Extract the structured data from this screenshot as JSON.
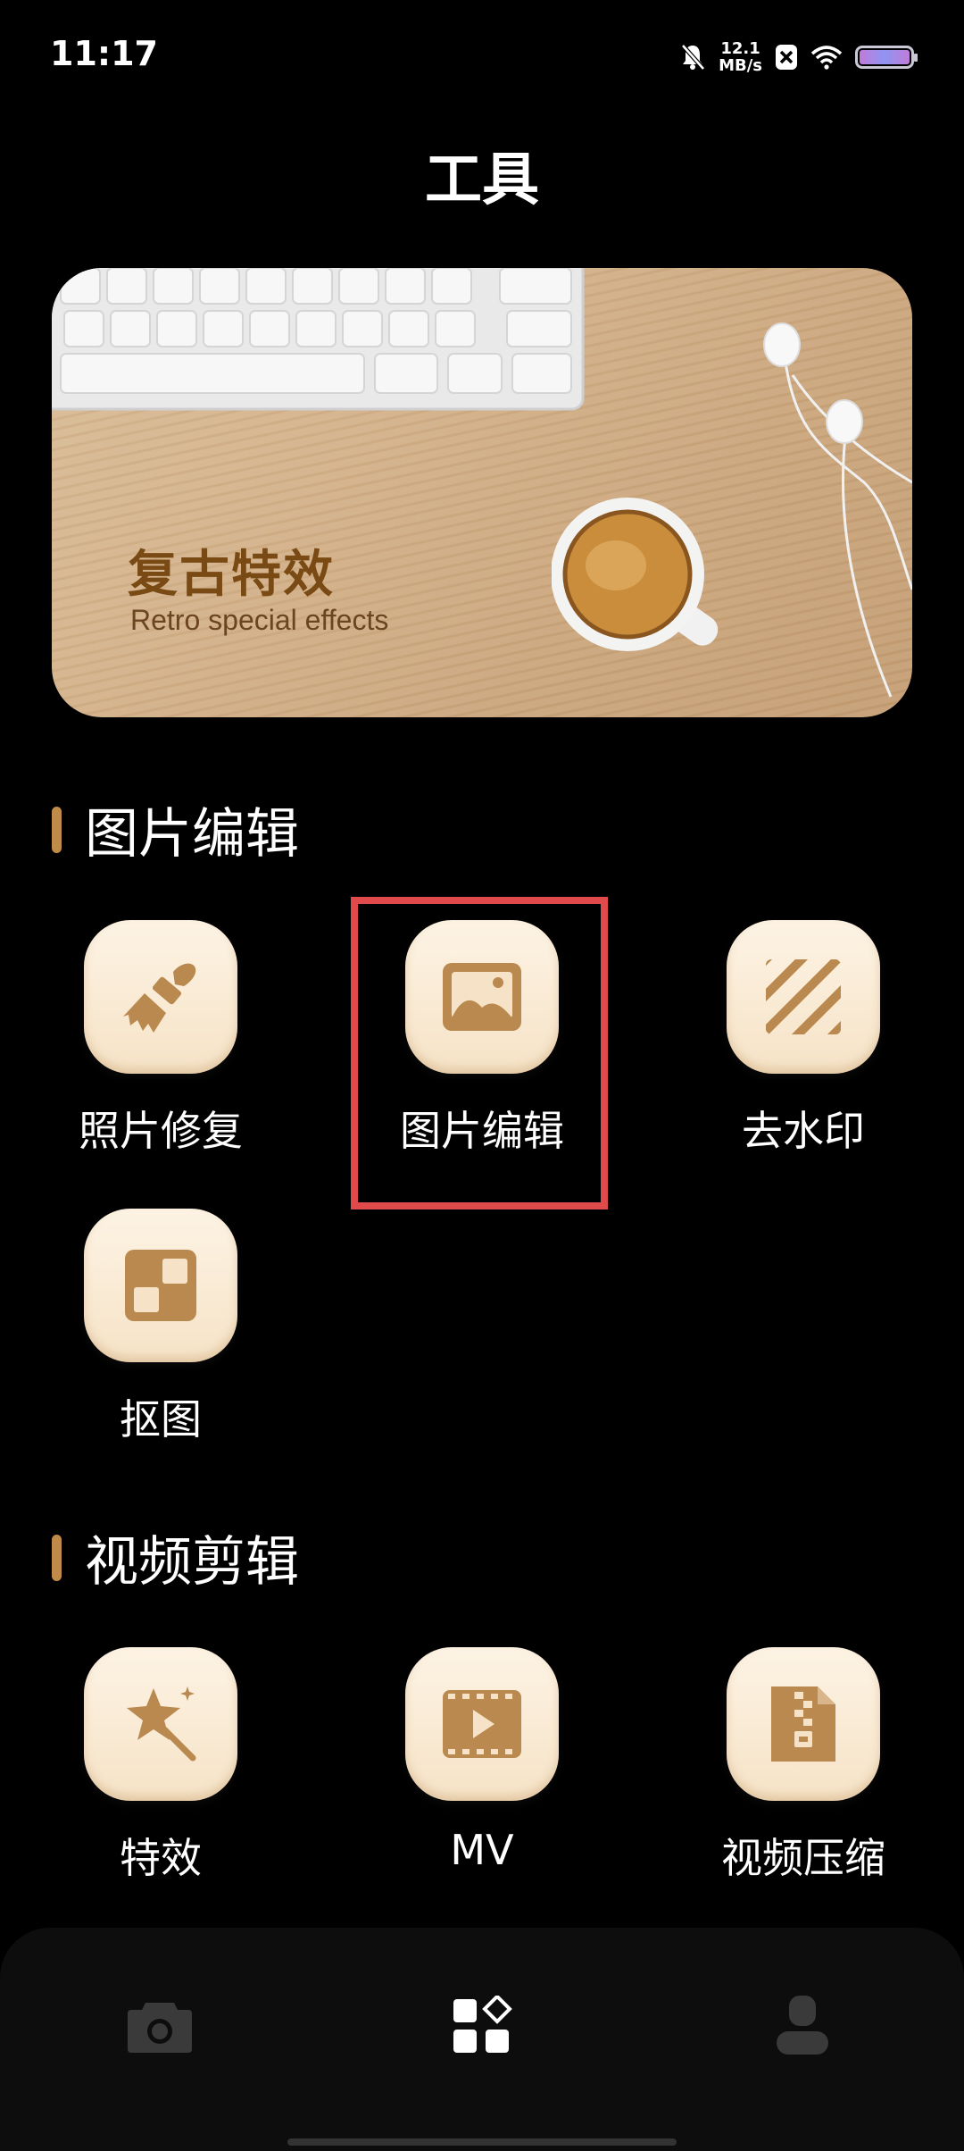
{
  "status_bar": {
    "time": "11:17",
    "net_speed_value": "12.1",
    "net_speed_unit": "MB/s",
    "icons": [
      "mute-bell-icon",
      "close-x-icon",
      "wifi-icon",
      "battery-icon"
    ]
  },
  "header": {
    "title": "工具"
  },
  "banner": {
    "title": "复古特效",
    "subtitle": "Retro special effects"
  },
  "sections": [
    {
      "title": "图片编辑",
      "tools": [
        {
          "label": "照片修复",
          "icon": "brush-icon"
        },
        {
          "label": "图片编辑",
          "icon": "image-icon"
        },
        {
          "label": "去水印",
          "icon": "stripes-icon"
        },
        {
          "label": "抠图",
          "icon": "cutout-icon"
        }
      ]
    },
    {
      "title": "视频剪辑",
      "tools": [
        {
          "label": "特效",
          "icon": "magic-wand-icon"
        },
        {
          "label": "MV",
          "icon": "video-film-icon"
        },
        {
          "label": "视频压缩",
          "icon": "zip-file-icon"
        }
      ]
    }
  ],
  "bottom_nav": {
    "items": [
      {
        "icon": "camera-icon",
        "active": false
      },
      {
        "icon": "tools-grid-icon",
        "active": true
      },
      {
        "icon": "user-icon",
        "active": false
      }
    ]
  },
  "colors": {
    "accent": "#c08a48",
    "icon_brown": "#b9894f",
    "tile_bg": "#f8e8d0",
    "highlight": "#e04a4a"
  }
}
